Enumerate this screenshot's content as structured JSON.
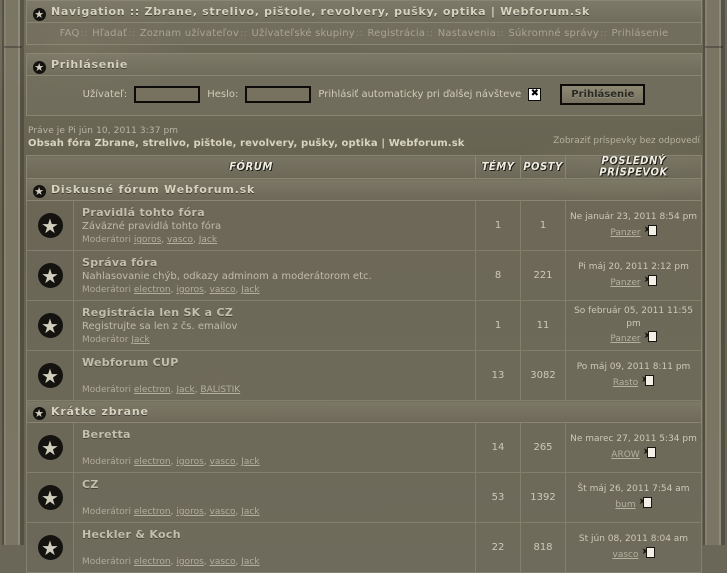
{
  "theme": {
    "bg": "#6b6758",
    "panel_border": "#8a8674",
    "text": "#c9c5b4",
    "heading": "#d6d2c0",
    "link": "#b3af9f"
  },
  "navigation": {
    "title": "Navigation :: Zbrane, strelivo, pištole, revolvery, pušky, optika | Webforum.sk",
    "star_icon": "star-icon",
    "links": [
      "FAQ",
      "Hľadať",
      "Zoznam užívateľov",
      "Užívateľské skupiny",
      "Registrácia",
      "Nastavenia",
      "Súkromné správy",
      "Prihlásenie"
    ],
    "separator": "::"
  },
  "login": {
    "title": "Prihlásenie",
    "star_icon": "star-icon",
    "username_label": "Užívateľ:",
    "username_value": "",
    "username_placeholder": "",
    "password_label": "Heslo:",
    "password_value": "",
    "password_placeholder": "",
    "autologin_label": "Prihlásiť automaticky pri ďalšej návšteve",
    "autologin_checked_glyph": "✖",
    "submit_label": "Prihlásenie"
  },
  "meta": {
    "current_time": "Práve je Pi jún 10, 2011 3:37 pm",
    "breadcrumb": "Obsah fóra Zbrane, strelivo, pištole, revolvery, pušky, optika | Webforum.sk",
    "unanswered_link": "Zobraziť príspevky bez odpovedí"
  },
  "table": {
    "headers": {
      "forum": "FÓRUM",
      "topics": "TÉMY",
      "posts": "POSTY",
      "lastpost": "POSLEDNÝ PRÍSPEVOK"
    },
    "moderators_label_plural": "Moderátori",
    "moderators_label_single": "Moderátor",
    "goto_icon": "goto-last-post-icon"
  },
  "categories": [
    {
      "name": "Diskusné fórum Webforum.sk",
      "star_icon": "star-icon",
      "forums": [
        {
          "icon": "forum-star-icon",
          "title": "Pravidlá tohto fóra",
          "description": "Záväzné pravidlá tohto fóra",
          "mods_label": "Moderátori",
          "moderators": [
            "igoros",
            "vasco",
            "Jack"
          ],
          "topics": "1",
          "posts": "1",
          "last_date": "Ne január 23, 2011 8:54 pm",
          "last_user": "Panzer"
        },
        {
          "icon": "forum-star-icon",
          "title": "Správa fóra",
          "description": "Nahlasovanie chýb, odkazy adminom a moderátorom etc.",
          "mods_label": "Moderátori",
          "moderators": [
            "electron",
            "igoros",
            "vasco",
            "Jack"
          ],
          "topics": "8",
          "posts": "221",
          "last_date": "Pi máj 20, 2011 2:12 pm",
          "last_user": "Panzer"
        },
        {
          "icon": "forum-star-icon",
          "title": "Registrácia len SK a CZ",
          "description": "Registrujte sa len z čs. emailov",
          "mods_label": "Moderátor",
          "moderators": [
            "Jack"
          ],
          "topics": "1",
          "posts": "11",
          "last_date": "So február 05, 2011 11:55 pm",
          "last_user": "Panzer"
        },
        {
          "icon": "forum-star-icon",
          "title": "Webforum CUP",
          "description": "",
          "mods_label": "Moderátori",
          "moderators": [
            "electron",
            "Jack",
            "BALISTIK"
          ],
          "topics": "13",
          "posts": "3082",
          "last_date": "Po máj 09, 2011 8:11 pm",
          "last_user": "Rasto"
        }
      ]
    },
    {
      "name": "Krátke zbrane",
      "star_icon": "star-icon",
      "forums": [
        {
          "icon": "forum-star-icon",
          "title": "Beretta",
          "description": "",
          "mods_label": "Moderátori",
          "moderators": [
            "electron",
            "igoros",
            "vasco",
            "Jack"
          ],
          "topics": "14",
          "posts": "265",
          "last_date": "Ne marec 27, 2011 5:34 pm",
          "last_user": "AROW"
        },
        {
          "icon": "forum-star-icon",
          "title": "CZ",
          "description": "",
          "mods_label": "Moderátori",
          "moderators": [
            "electron",
            "igoros",
            "vasco",
            "Jack"
          ],
          "topics": "53",
          "posts": "1392",
          "last_date": "Št máj 26, 2011 7:54 am",
          "last_user": "bum"
        },
        {
          "icon": "forum-star-icon",
          "title": "Heckler & Koch",
          "description": "",
          "mods_label": "Moderátori",
          "moderators": [
            "electron",
            "igoros",
            "vasco",
            "Jack"
          ],
          "topics": "22",
          "posts": "818",
          "last_date": "St jún 08, 2011 8:04 am",
          "last_user": "vasco"
        }
      ]
    }
  ]
}
